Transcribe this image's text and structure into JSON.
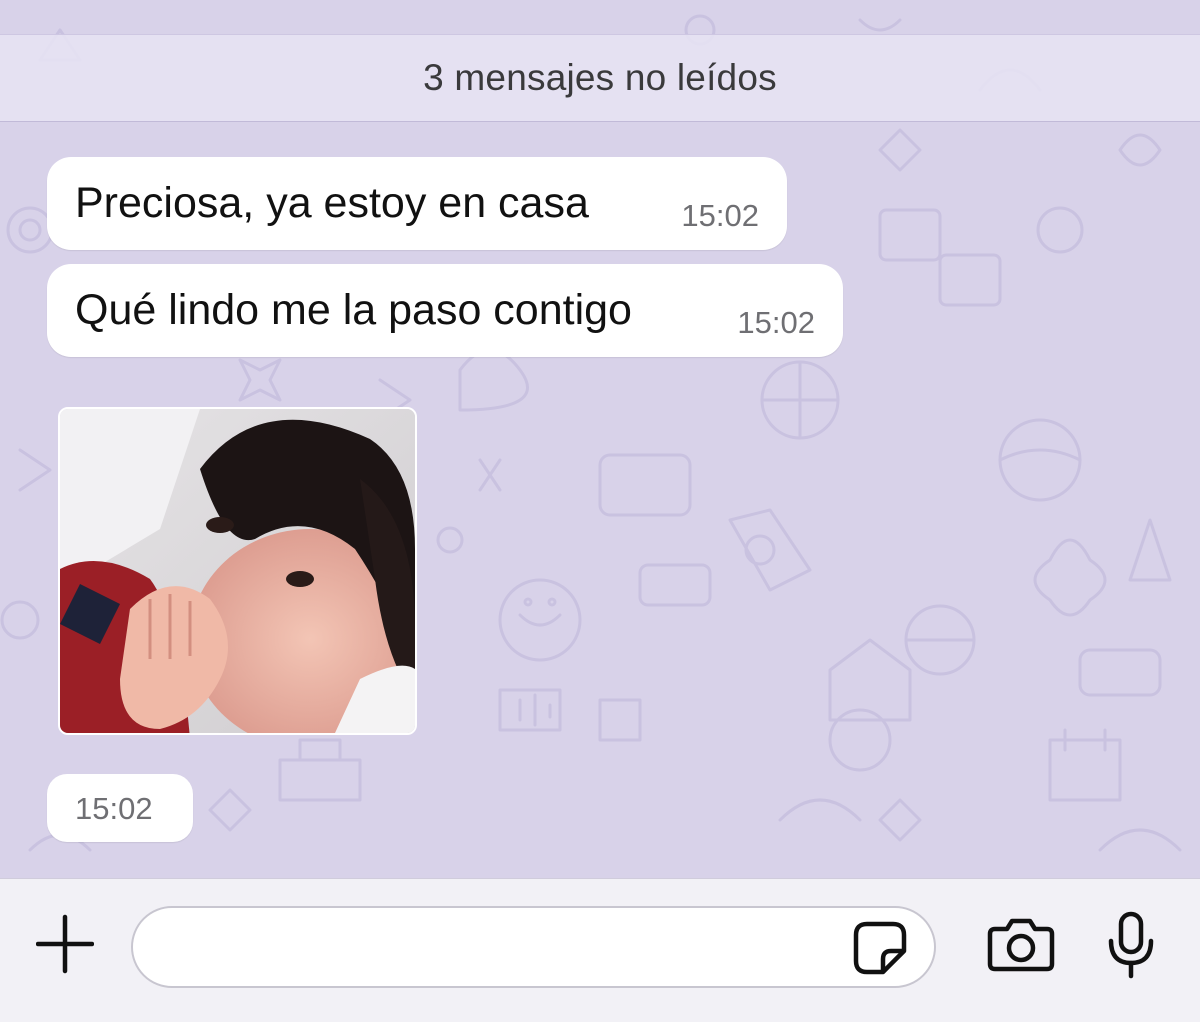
{
  "unread_banner": {
    "text": "3 mensajes no leídos"
  },
  "messages": [
    {
      "text": "Preciosa, ya estoy en casa",
      "time": "15:02"
    },
    {
      "text": "Qué lindo me la paso contigo",
      "time": "15:02"
    }
  ],
  "photo_message": {
    "time": "15:02"
  },
  "input_bar": {
    "placeholder": ""
  },
  "icons": {
    "attach": "plus-icon",
    "sticker": "sticker-icon",
    "camera": "camera-icon",
    "microphone": "microphone-icon"
  },
  "colors": {
    "chat_background": "#d8d2e9",
    "bubble": "#ffffff",
    "input_bar": "#f2f1f6",
    "icon": "#111111"
  }
}
